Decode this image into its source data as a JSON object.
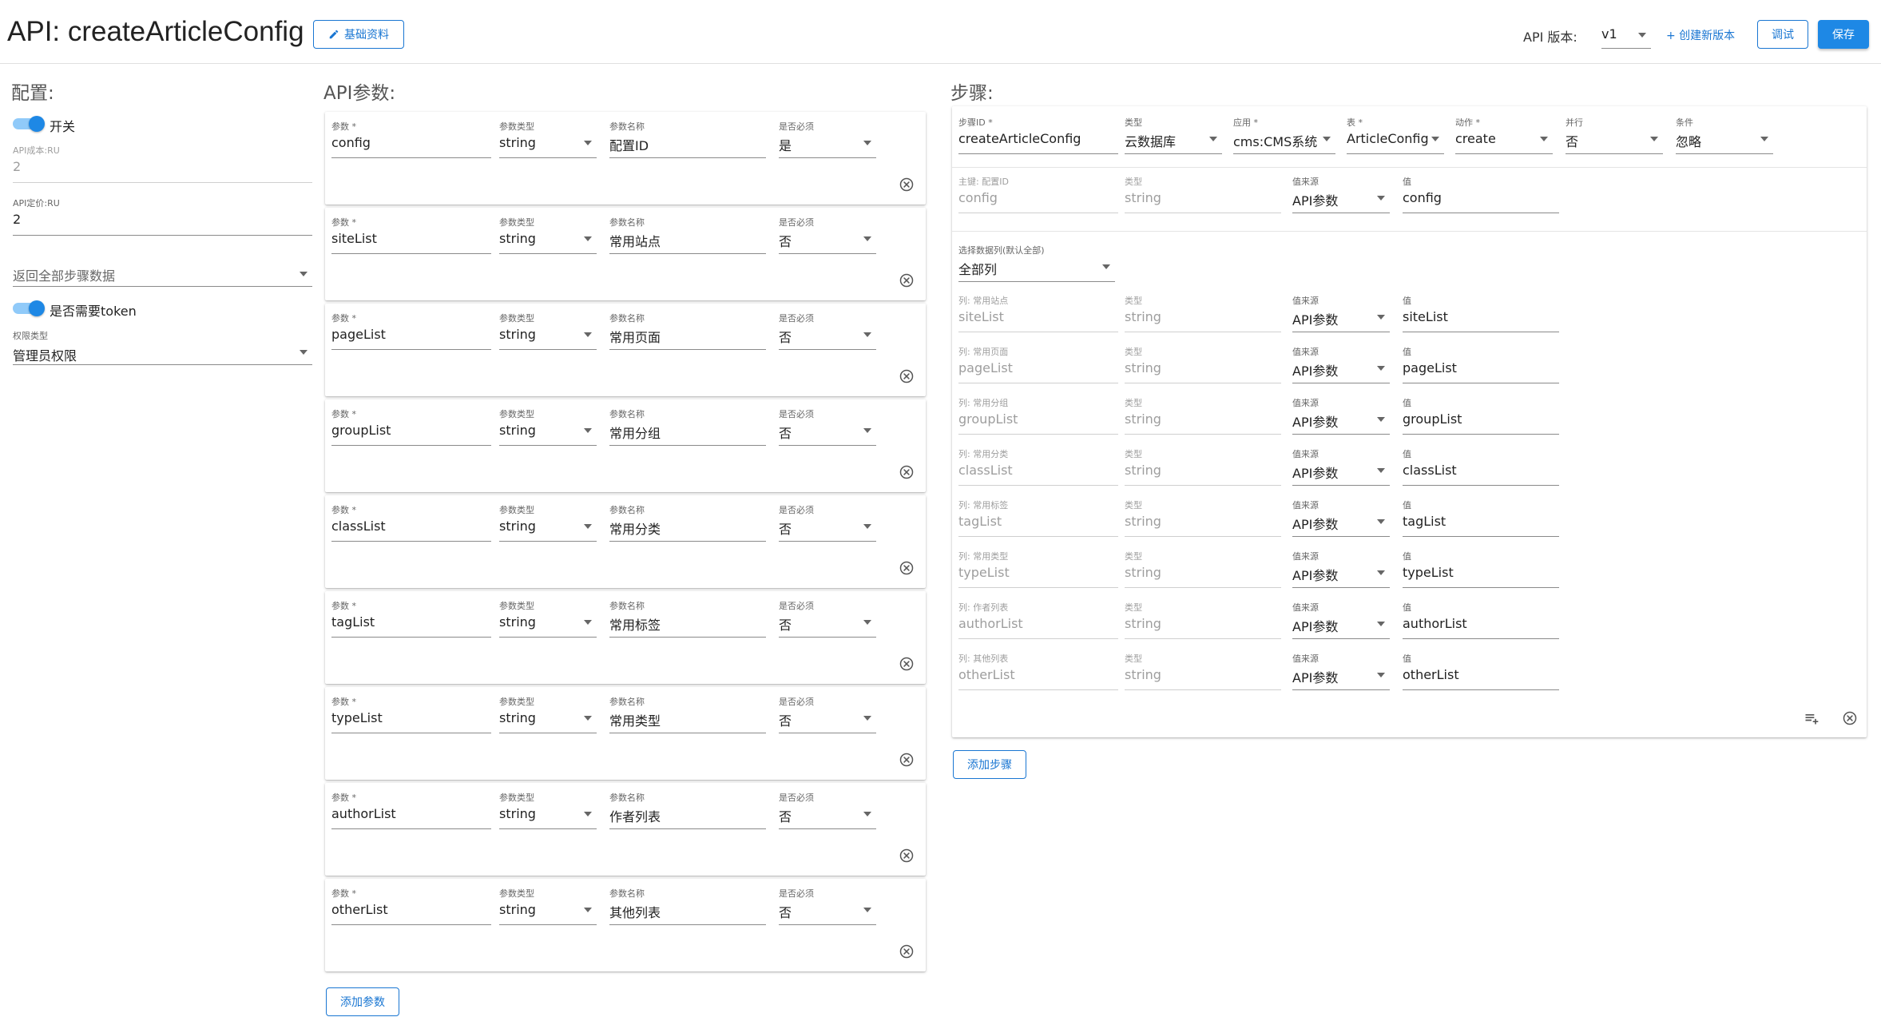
{
  "header": {
    "title": "API: createArticleConfig",
    "basic_info_label": "基础资料",
    "version_label": "API 版本:",
    "version_value": "v1",
    "create_version_label": "+ 创建新版本",
    "debug_label": "调试",
    "save_label": "保存"
  },
  "config": {
    "title": "配置:",
    "switch_label": "开关",
    "cost_label": "API成本:RU",
    "cost_value": "2",
    "price_label": "API定价:RU",
    "price_value": "2",
    "return_placeholder": "返回全部步骤数据",
    "token_label": "是否需要token",
    "perm_label": "权限类型",
    "perm_value": "管理员权限"
  },
  "params": {
    "title": "API参数:",
    "param_label": "参数 *",
    "type_label": "参数类型",
    "name_label": "参数名称",
    "required_label": "是否必须",
    "add_label": "添加参数",
    "items": [
      {
        "param": "config",
        "type": "string",
        "name": "配置ID",
        "required": "是"
      },
      {
        "param": "siteList",
        "type": "string",
        "name": "常用站点",
        "required": "否"
      },
      {
        "param": "pageList",
        "type": "string",
        "name": "常用页面",
        "required": "否"
      },
      {
        "param": "groupList",
        "type": "string",
        "name": "常用分组",
        "required": "否"
      },
      {
        "param": "classList",
        "type": "string",
        "name": "常用分类",
        "required": "否"
      },
      {
        "param": "tagList",
        "type": "string",
        "name": "常用标签",
        "required": "否"
      },
      {
        "param": "typeList",
        "type": "string",
        "name": "常用类型",
        "required": "否"
      },
      {
        "param": "authorList",
        "type": "string",
        "name": "作者列表",
        "required": "否"
      },
      {
        "param": "otherList",
        "type": "string",
        "name": "其他列表",
        "required": "否"
      }
    ]
  },
  "steps": {
    "title": "步骤:",
    "add_label": "添加步骤",
    "step": {
      "id_label": "步骤ID *",
      "id_value": "createArticleConfig",
      "type_label": "类型",
      "type_value": "云数据库",
      "app_label": "应用 *",
      "app_value": "cms:CMS系统",
      "table_label": "表 *",
      "table_value": "ArticleConfig",
      "action_label": "动作 *",
      "action_value": "create",
      "parallel_label": "并行",
      "parallel_value": "否",
      "cond_label": "条件",
      "cond_value": "忽略"
    },
    "primary": {
      "key_label": "主键: 配置ID",
      "key_value": "config",
      "type_label": "类型",
      "type_value": "string",
      "source_label": "值来源",
      "source_value": "API参数",
      "value_label": "值",
      "value_value": "config"
    },
    "columns_label": "选择数据列(默认全部)",
    "columns_value": "全部列",
    "col_type_label": "类型",
    "col_source_label": "值来源",
    "col_value_label": "值",
    "rows": [
      {
        "label": "列: 常用站点",
        "name": "siteList",
        "type": "string",
        "source": "API参数",
        "value": "siteList"
      },
      {
        "label": "列: 常用页面",
        "name": "pageList",
        "type": "string",
        "source": "API参数",
        "value": "pageList"
      },
      {
        "label": "列: 常用分组",
        "name": "groupList",
        "type": "string",
        "source": "API参数",
        "value": "groupList"
      },
      {
        "label": "列: 常用分类",
        "name": "classList",
        "type": "string",
        "source": "API参数",
        "value": "classList"
      },
      {
        "label": "列: 常用标签",
        "name": "tagList",
        "type": "string",
        "source": "API参数",
        "value": "tagList"
      },
      {
        "label": "列: 常用类型",
        "name": "typeList",
        "type": "string",
        "source": "API参数",
        "value": "typeList"
      },
      {
        "label": "列: 作者列表",
        "name": "authorList",
        "type": "string",
        "source": "API参数",
        "value": "authorList"
      },
      {
        "label": "列: 其他列表",
        "name": "otherList",
        "type": "string",
        "source": "API参数",
        "value": "otherList"
      }
    ]
  },
  "colors": {
    "accent": "#1976d2",
    "primary_btn": "#1e88e5",
    "toggle_track": "#90caf9"
  }
}
